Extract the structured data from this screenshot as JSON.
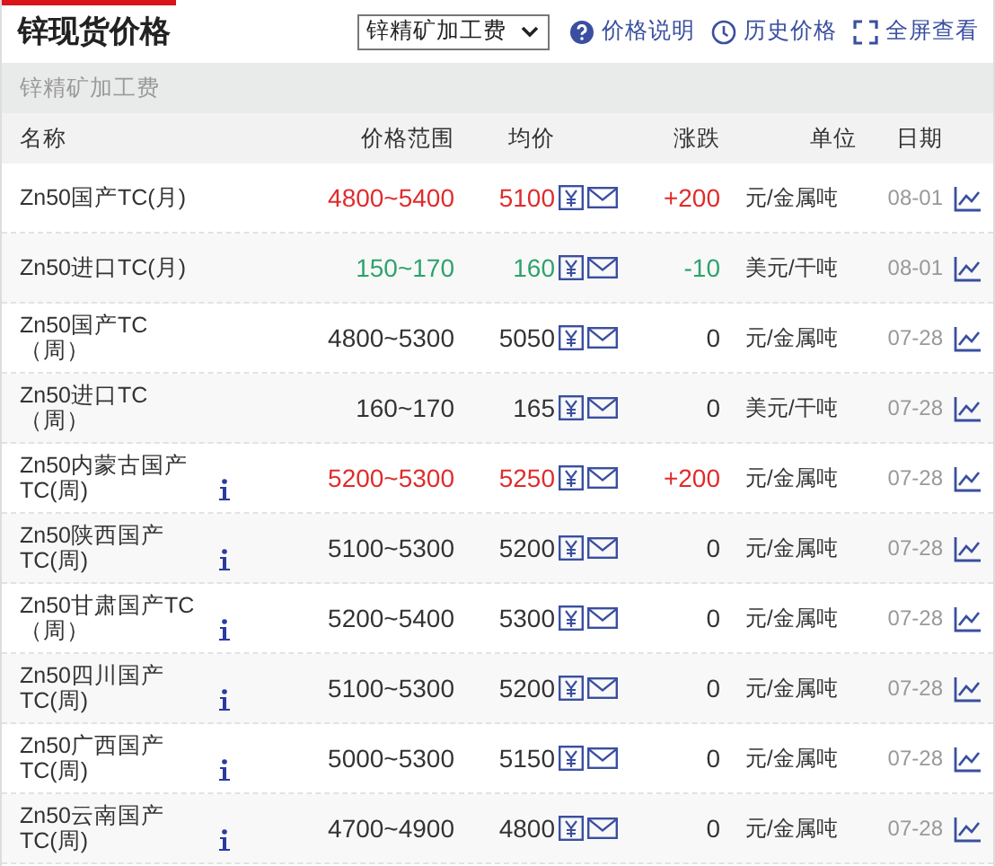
{
  "header": {
    "title": "锌现货价格",
    "select_value": "锌精矿加工费",
    "links": [
      {
        "kind": "help",
        "label": "价格说明"
      },
      {
        "kind": "history",
        "label": "历史价格"
      },
      {
        "kind": "fullscreen",
        "label": "全屏查看"
      }
    ]
  },
  "section": {
    "title": "锌精矿加工费"
  },
  "table": {
    "columns": [
      "名称",
      "价格范围",
      "均价",
      "涨跌",
      "单位",
      "日期"
    ],
    "rows": [
      {
        "name": "Zn50国产TC(月)",
        "info": false,
        "range": "4800~5400",
        "avg": "5100",
        "change": "+200",
        "unit": "元/金属吨",
        "date": "08-01",
        "color": "#e02b2b"
      },
      {
        "name": "Zn50进口TC(月)",
        "info": false,
        "range": "150~170",
        "avg": "160",
        "change": "-10",
        "unit": "美元/干吨",
        "date": "08-01",
        "color": "#2da26c"
      },
      {
        "name": "Zn50国产TC（周）",
        "info": false,
        "range": "4800~5300",
        "avg": "5050",
        "change": "0",
        "unit": "元/金属吨",
        "date": "07-28",
        "color": "#333333"
      },
      {
        "name": "Zn50进口TC（周）",
        "info": false,
        "range": "160~170",
        "avg": "165",
        "change": "0",
        "unit": "美元/干吨",
        "date": "07-28",
        "color": "#333333"
      },
      {
        "name": "Zn50内蒙古国产TC(周)",
        "info": true,
        "range": "5200~5300",
        "avg": "5250",
        "change": "+200",
        "unit": "元/金属吨",
        "date": "07-28",
        "color": "#e02b2b"
      },
      {
        "name": "Zn50陕西国产TC(周)",
        "info": true,
        "range": "5100~5300",
        "avg": "5200",
        "change": "0",
        "unit": "元/金属吨",
        "date": "07-28",
        "color": "#333333"
      },
      {
        "name": "Zn50甘肃国产TC（周）",
        "info": true,
        "range": "5200~5400",
        "avg": "5300",
        "change": "0",
        "unit": "元/金属吨",
        "date": "07-28",
        "color": "#333333"
      },
      {
        "name": "Zn50四川国产TC(周)",
        "info": true,
        "range": "5100~5300",
        "avg": "5200",
        "change": "0",
        "unit": "元/金属吨",
        "date": "07-28",
        "color": "#333333"
      },
      {
        "name": "Zn50广西国产TC(周)",
        "info": true,
        "range": "5000~5300",
        "avg": "5150",
        "change": "0",
        "unit": "元/金属吨",
        "date": "07-28",
        "color": "#333333"
      },
      {
        "name": "Zn50云南国产TC(周)",
        "info": true,
        "range": "4700~4900",
        "avg": "4800",
        "change": "0",
        "unit": "元/金属吨",
        "date": "07-28",
        "color": "#333333"
      }
    ]
  }
}
